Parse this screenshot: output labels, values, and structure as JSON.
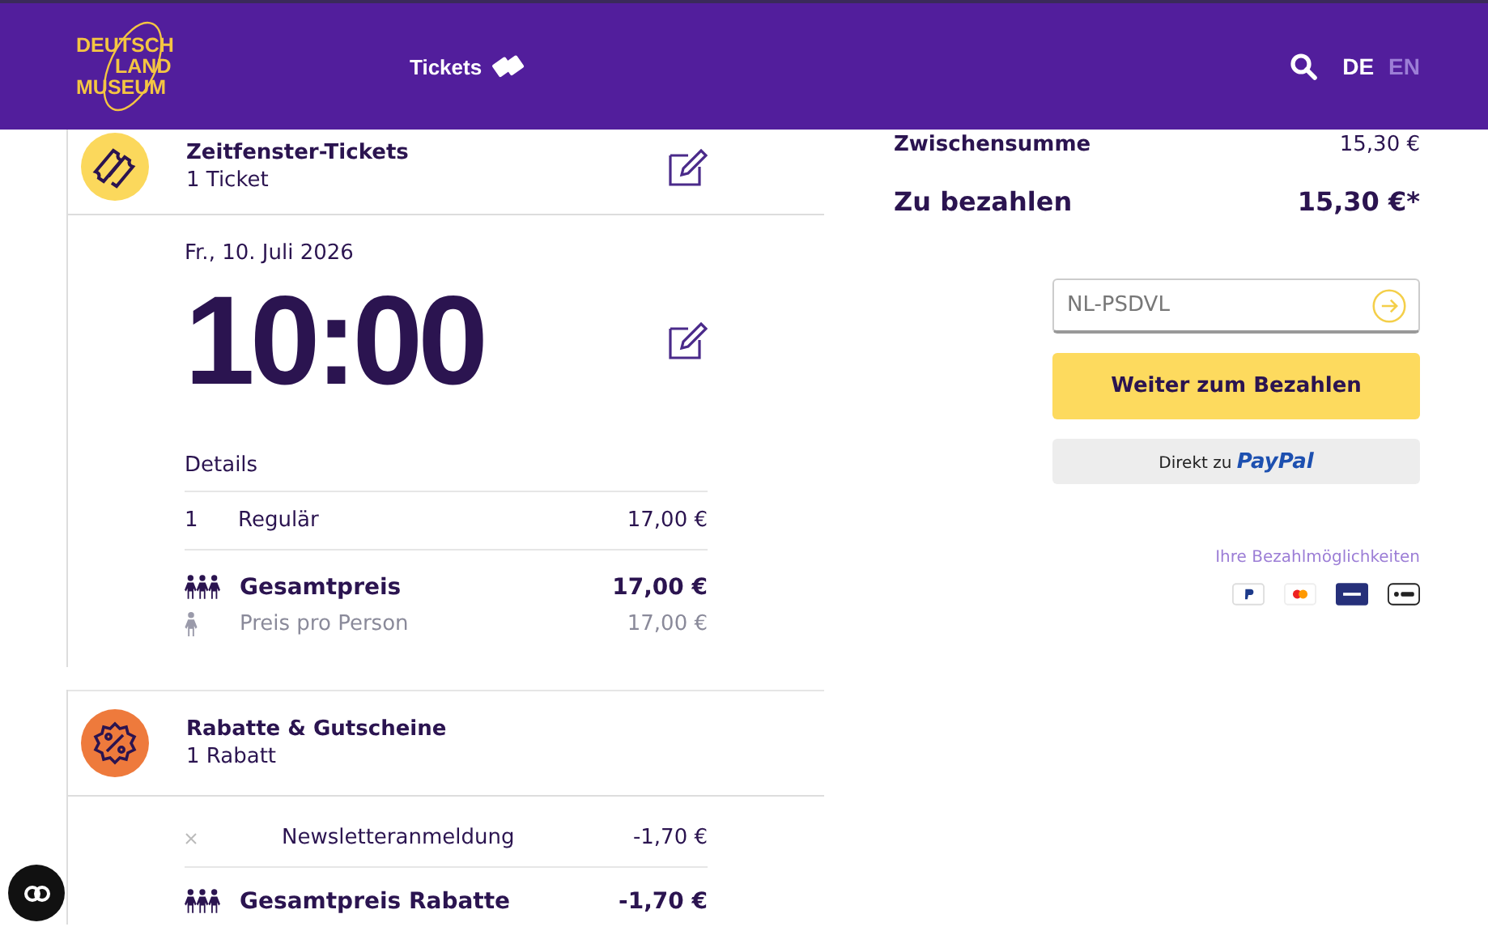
{
  "header": {
    "logo_lines": [
      "DEUTSCH",
      "LAND",
      "MUSEUM"
    ],
    "nav_link": "Tickets",
    "languages": [
      {
        "label": "DE",
        "selected": true
      },
      {
        "label": "EN",
        "selected": false
      }
    ]
  },
  "ticket_card": {
    "title": "Zeitfenster-Tickets",
    "subtitle": "1 Ticket",
    "date": "Fr., 10. Juli 2026",
    "time": "10:00",
    "details_label": "Details",
    "items": [
      {
        "qty": "1",
        "name": "Regulär",
        "price": "17,00 €"
      }
    ],
    "total_label": "Gesamtpreis",
    "total": "17,00 €",
    "per_person_label": "Preis pro Person",
    "per_person": "17,00 €"
  },
  "discount_card": {
    "title": "Rabatte & Gutscheine",
    "subtitle": "1 Rabatt",
    "items": [
      {
        "name": "Newsletteranmeldung",
        "amount": "-1,70 €"
      }
    ],
    "total_label": "Gesamtpreis Rabatte",
    "total": "-1,70 €"
  },
  "summary": {
    "subtotal_label": "Zwischensumme",
    "subtotal": "15,30 €",
    "due_label": "Zu bezahlen",
    "due": "15,30 €*",
    "voucher_field": {
      "value": "NL-PSDVL"
    },
    "pay_button": "Weiter zum Bezahlen",
    "paypal_button": {
      "prefix": "Direkt zu",
      "brand": "PayPal"
    },
    "payment_methods_label": "Ihre Bezahlmöglichkeiten"
  }
}
